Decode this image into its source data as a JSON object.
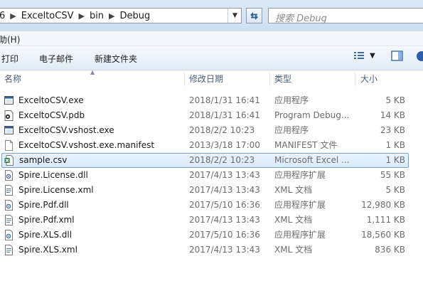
{
  "address": {
    "crumbs": [
      "6",
      "ExceltoCSV",
      "bin",
      "Debug"
    ],
    "search_placeholder": "搜索 Debug"
  },
  "menu": {
    "help": "助(H)"
  },
  "toolbar": {
    "print": "打印",
    "email": "电子邮件",
    "new_folder": "新建文件夹"
  },
  "columns": {
    "name": "名称",
    "date": "修改日期",
    "type": "类型",
    "size": "大小"
  },
  "files": [
    {
      "name": "ExceltoCSV.exe",
      "date": "2018/1/31 16:41",
      "type": "应用程序",
      "size": "5 KB",
      "icon": "exe-icon"
    },
    {
      "name": "ExceltoCSV.pdb",
      "date": "2018/1/31 16:41",
      "type": "Program Debug...",
      "size": "14 KB",
      "icon": "pdb-icon"
    },
    {
      "name": "ExceltoCSV.vshost.exe",
      "date": "2018/2/2 10:23",
      "type": "应用程序",
      "size": "23 KB",
      "icon": "exe-icon"
    },
    {
      "name": "ExceltoCSV.vshost.exe.manifest",
      "date": "2013/3/18 17:00",
      "type": "MANIFEST 文件",
      "size": "1 KB",
      "icon": "blank-file-icon"
    },
    {
      "name": "sample.csv",
      "date": "2018/2/2 10:23",
      "type": "Microsoft Excel ...",
      "size": "1 KB",
      "icon": "excel-csv-icon",
      "selected": true
    },
    {
      "name": "Spire.License.dll",
      "date": "2017/4/13 13:43",
      "type": "应用程序扩展",
      "size": "55 KB",
      "icon": "dll-icon"
    },
    {
      "name": "Spire.License.xml",
      "date": "2017/4/13 13:43",
      "type": "XML 文档",
      "size": "5 KB",
      "icon": "xml-icon"
    },
    {
      "name": "Spire.Pdf.dll",
      "date": "2017/5/10 16:36",
      "type": "应用程序扩展",
      "size": "12,980 KB",
      "icon": "dll-icon"
    },
    {
      "name": "Spire.Pdf.xml",
      "date": "2017/4/13 13:43",
      "type": "XML 文档",
      "size": "1,111 KB",
      "icon": "xml-icon"
    },
    {
      "name": "Spire.XLS.dll",
      "date": "2017/5/10 16:36",
      "type": "应用程序扩展",
      "size": "18,560 KB",
      "icon": "dll-icon"
    },
    {
      "name": "Spire.XLS.xml",
      "date": "2017/4/13 13:43",
      "type": "XML 文档",
      "size": "836 KB",
      "icon": "xml-icon"
    }
  ]
}
